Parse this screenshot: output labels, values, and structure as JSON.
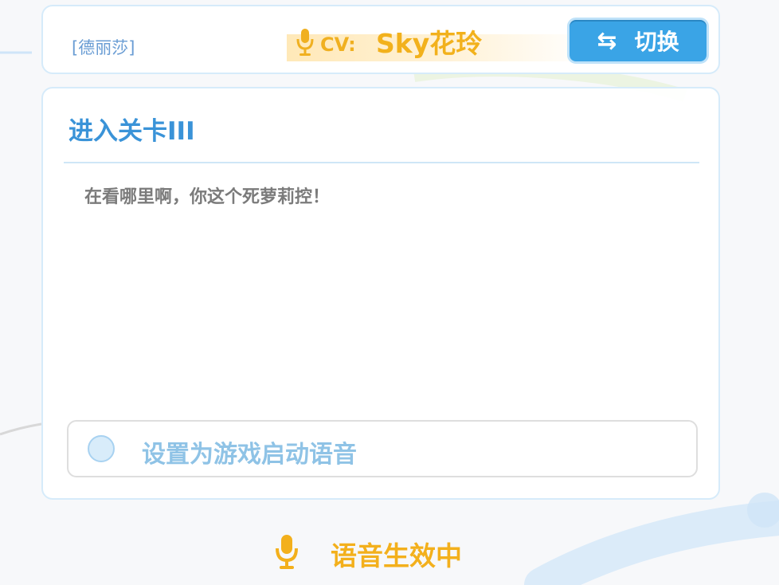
{
  "header": {
    "character_name": "[德丽莎]",
    "cv_label": "CV:",
    "cv_name": "Sky花玲",
    "switch_label": "切换",
    "switch_arrow": "⇆"
  },
  "voice_line": {
    "title": "进入关卡III",
    "text": "在看哪里啊，你这个死萝莉控！"
  },
  "startup_option": {
    "label": "设置为游戏启动语音",
    "checked": false
  },
  "status": {
    "label": "语音生效中"
  },
  "colors": {
    "accent_blue": "#3aa4e6",
    "accent_gold": "#f2b11c",
    "text_gray": "#7b7b7b"
  },
  "icons": {
    "cv": "microphone-icon",
    "status": "microphone-icon",
    "switch": "swap-arrows-icon"
  }
}
